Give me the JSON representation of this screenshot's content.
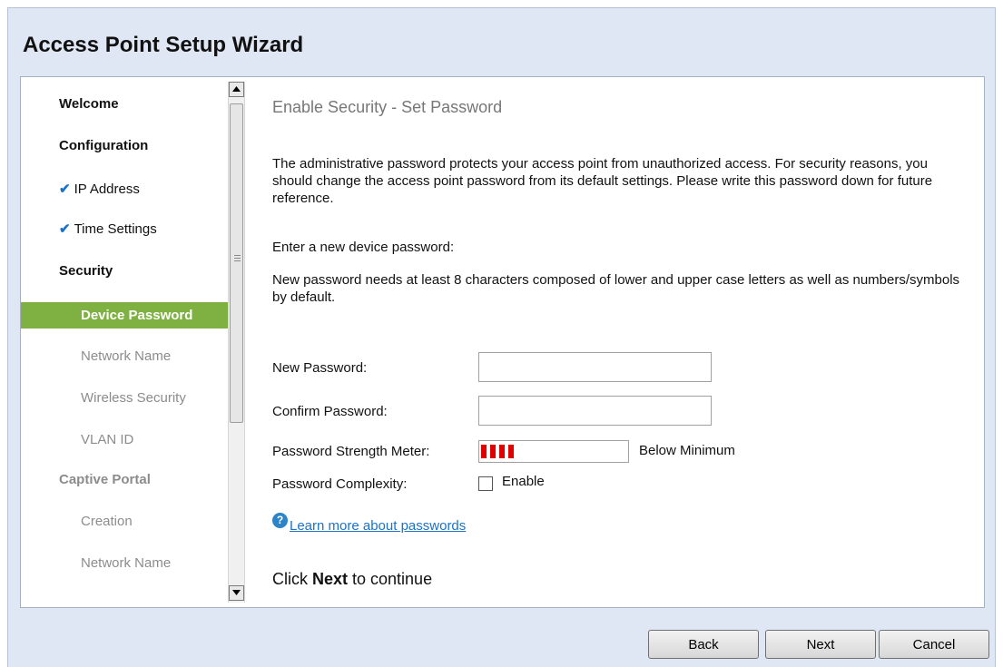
{
  "wizard": {
    "title": "Access Point Setup Wizard"
  },
  "nav": {
    "items": [
      {
        "label": "Welcome",
        "state": "section"
      },
      {
        "label": "Configuration",
        "state": "section"
      },
      {
        "label": "IP Address",
        "state": "done"
      },
      {
        "label": "Time Settings",
        "state": "done"
      },
      {
        "label": "Security",
        "state": "section"
      },
      {
        "label": "Device Password",
        "state": "active"
      },
      {
        "label": "Network Name",
        "state": "pending"
      },
      {
        "label": "Wireless Security",
        "state": "pending"
      },
      {
        "label": "VLAN ID",
        "state": "pending"
      },
      {
        "label": "Captive Portal",
        "state": "section-disabled"
      },
      {
        "label": "Creation",
        "state": "pending"
      },
      {
        "label": "Network Name",
        "state": "pending"
      }
    ],
    "check_glyph": "✔"
  },
  "content": {
    "heading": "Enable Security - Set Password",
    "intro": "The administrative password protects your access point from unauthorized access. For security reasons, you should change the access point password from its default settings. Please write this password down for future reference.",
    "prompt": "Enter a new device password:",
    "requirements": "New password needs at least 8 characters composed of lower and upper case letters as well as numbers/symbols by default.",
    "new_password_label": "New Password:",
    "new_password_value": "",
    "confirm_password_label": "Confirm Password:",
    "confirm_password_value": "",
    "strength_label": "Password Strength Meter:",
    "strength_text": "Below Minimum",
    "strength_level": 0.24,
    "complexity_label": "Password Complexity:",
    "complexity_checkbox_label": "Enable",
    "complexity_checked": false,
    "help_icon": "?",
    "help_link": "Learn more about passwords",
    "continue_prefix": "Click ",
    "continue_bold": "Next",
    "continue_suffix": " to continue"
  },
  "buttons": {
    "back": "Back",
    "next": "Next",
    "cancel": "Cancel"
  },
  "colors": {
    "active_nav": "#7eb142",
    "meter_red": "#e00000",
    "link": "#1a73c8",
    "frame": "#dfe6f4"
  }
}
